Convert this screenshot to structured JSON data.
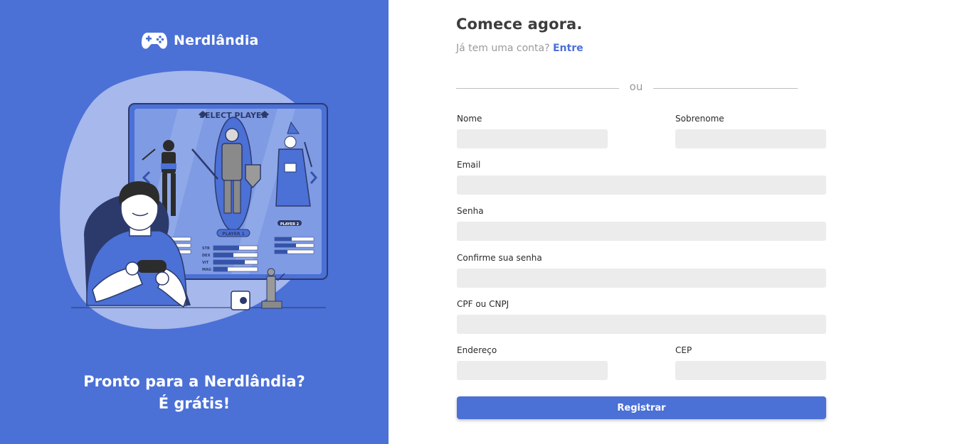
{
  "brand": {
    "name": "Nerdlândia",
    "icon": "gamepad-icon"
  },
  "illustration": {
    "screen_title": "SELECT PLAYER",
    "player1_label": "PLAYER 1",
    "player2_label": "PLAYER 2",
    "stats": [
      "STR",
      "DEX",
      "VIT",
      "MAG"
    ]
  },
  "tagline": {
    "line1": "Pronto para a Nerdlândia?",
    "line2": "É grátis!"
  },
  "form": {
    "title": "Comece agora.",
    "subtitle_text": "Já tem uma conta?",
    "login_link": "Entre",
    "divider_text": "ou",
    "fields": {
      "first_name": {
        "label": "Nome",
        "value": ""
      },
      "last_name": {
        "label": "Sobrenome",
        "value": ""
      },
      "email": {
        "label": "Email",
        "value": ""
      },
      "password": {
        "label": "Senha",
        "value": ""
      },
      "confirm_password": {
        "label": "Confirme sua senha",
        "value": ""
      },
      "document": {
        "label": "CPF ou CNPJ",
        "value": ""
      },
      "address": {
        "label": "Endereço",
        "value": ""
      },
      "zip": {
        "label": "CEP",
        "value": ""
      }
    },
    "submit_label": "Registrar"
  },
  "colors": {
    "primary": "#4b70d6",
    "input_bg": "#ececec",
    "title": "#3d3d3d",
    "muted": "#9a9a9a"
  }
}
